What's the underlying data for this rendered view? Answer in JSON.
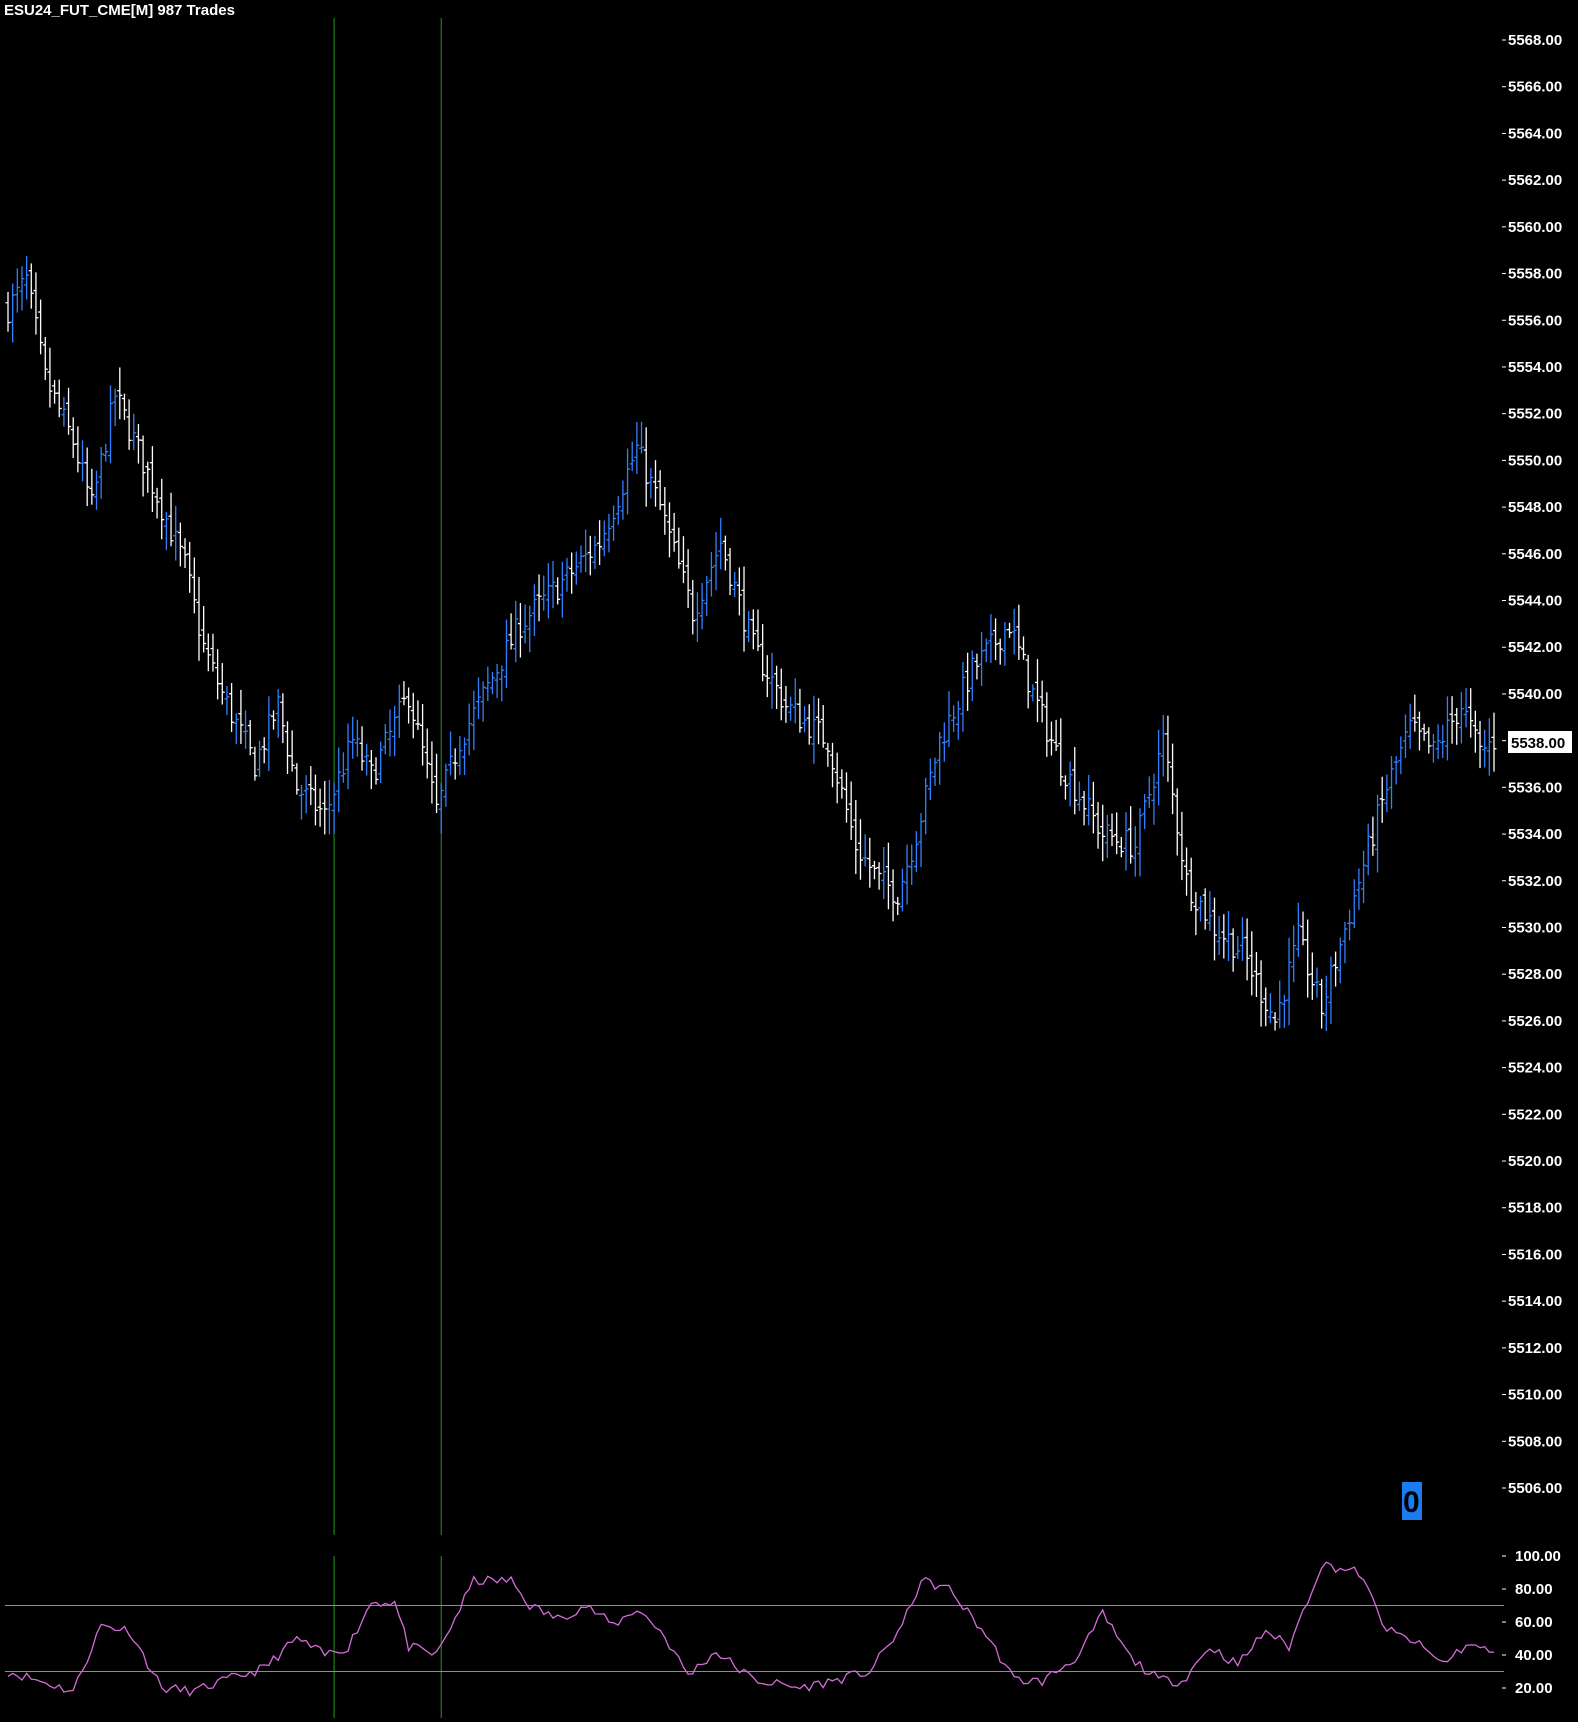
{
  "chart_title": "ESU24_FUT_CME[M] 987  Trades",
  "price_panel": {
    "y_ticks": [
      "5568.00",
      "5566.00",
      "5564.00",
      "5562.00",
      "5560.00",
      "5558.00",
      "5556.00",
      "5554.00",
      "5552.00",
      "5550.00",
      "5548.00",
      "5546.00",
      "5544.00",
      "5542.00",
      "5540.00",
      "5538.00",
      "5536.00",
      "5534.00",
      "5532.00",
      "5530.00",
      "5528.00",
      "5526.00",
      "5524.00",
      "5522.00",
      "5520.00",
      "5518.00",
      "5516.00",
      "5514.00",
      "5512.00",
      "5510.00",
      "5508.00",
      "5506.00"
    ],
    "last_price_label": "5538.00",
    "counter_label": "0"
  },
  "oscillator_panel": {
    "y_ticks": [
      "100.00",
      "80.00",
      "60.00",
      "40.00",
      "20.00"
    ]
  },
  "colors": {
    "background": "#000000",
    "bar_up": "#2f80ff",
    "bar_down": "#ffffff",
    "vertical_marker": "#1f9a1f",
    "oscillator": "#d46bd8",
    "oscillator_levels": "#20b8c8",
    "counter_box": "#1a7cf0"
  },
  "chart_data": [
    {
      "type": "ohlc",
      "title": "ESU24_FUT_CME[M] 987  Trades",
      "ylim": [
        5504,
        5570
      ],
      "x_marker_bars": [
        70,
        93
      ],
      "bar_count": 320,
      "close_path": [
        [
          0,
          5556.5
        ],
        [
          4,
          5557.7
        ],
        [
          8,
          5553.5
        ],
        [
          14,
          5550.8
        ],
        [
          18,
          5548.0
        ],
        [
          23,
          5552.8
        ],
        [
          32,
          5548.5
        ],
        [
          38,
          5545.5
        ],
        [
          42,
          5542.0
        ],
        [
          46,
          5540.0
        ],
        [
          53,
          5537.0
        ],
        [
          58,
          5539.5
        ],
        [
          62,
          5536.0
        ],
        [
          68,
          5534.8
        ],
        [
          74,
          5538.0
        ],
        [
          78,
          5536.5
        ],
        [
          86,
          5540.0
        ],
        [
          92,
          5535.0
        ],
        [
          97,
          5538.0
        ],
        [
          110,
          5543.0
        ],
        [
          120,
          5545.0
        ],
        [
          127,
          5546.5
        ],
        [
          135,
          5550.5
        ],
        [
          140,
          5548.0
        ],
        [
          147,
          5543.5
        ],
        [
          153,
          5546.5
        ],
        [
          160,
          5542.0
        ],
        [
          167,
          5539.5
        ],
        [
          176,
          5538.0
        ],
        [
          182,
          5533.5
        ],
        [
          187,
          5532.0
        ],
        [
          191,
          5531.5
        ],
        [
          195,
          5534.0
        ],
        [
          200,
          5538.0
        ],
        [
          207,
          5541.0
        ],
        [
          215,
          5543.0
        ],
        [
          220,
          5540.0
        ],
        [
          226,
          5537.0
        ],
        [
          235,
          5534.0
        ],
        [
          242,
          5533.5
        ],
        [
          248,
          5538.0
        ],
        [
          253,
          5532.0
        ],
        [
          259,
          5530.0
        ],
        [
          265,
          5529.0
        ],
        [
          272,
          5526.0
        ],
        [
          277,
          5529.5
        ],
        [
          282,
          5526.5
        ],
        [
          290,
          5532.0
        ],
        [
          296,
          5536.0
        ],
        [
          301,
          5538.5
        ],
        [
          306,
          5537.5
        ],
        [
          312,
          5539.5
        ],
        [
          316,
          5537.5
        ],
        [
          319,
          5538.0
        ]
      ]
    },
    {
      "type": "line",
      "ylim": [
        12,
        108
      ],
      "level_lines": [
        70,
        30
      ],
      "path": [
        [
          0,
          30
        ],
        [
          6,
          25
        ],
        [
          14,
          18
        ],
        [
          20,
          58
        ],
        [
          26,
          55
        ],
        [
          33,
          20
        ],
        [
          40,
          18
        ],
        [
          47,
          25
        ],
        [
          55,
          32
        ],
        [
          62,
          50
        ],
        [
          68,
          40
        ],
        [
          73,
          45
        ],
        [
          78,
          72
        ],
        [
          83,
          72
        ],
        [
          86,
          45
        ],
        [
          92,
          40
        ],
        [
          100,
          85
        ],
        [
          108,
          85
        ],
        [
          112,
          70
        ],
        [
          118,
          62
        ],
        [
          124,
          70
        ],
        [
          130,
          58
        ],
        [
          135,
          68
        ],
        [
          140,
          55
        ],
        [
          146,
          28
        ],
        [
          152,
          42
        ],
        [
          160,
          25
        ],
        [
          170,
          20
        ],
        [
          178,
          25
        ],
        [
          185,
          30
        ],
        [
          192,
          58
        ],
        [
          196,
          85
        ],
        [
          202,
          80
        ],
        [
          210,
          52
        ],
        [
          216,
          25
        ],
        [
          222,
          24
        ],
        [
          230,
          40
        ],
        [
          235,
          65
        ],
        [
          241,
          38
        ],
        [
          247,
          25
        ],
        [
          252,
          24
        ],
        [
          258,
          45
        ],
        [
          264,
          34
        ],
        [
          270,
          55
        ],
        [
          275,
          45
        ],
        [
          282,
          95
        ],
        [
          290,
          90
        ],
        [
          296,
          55
        ],
        [
          302,
          48
        ],
        [
          308,
          35
        ],
        [
          313,
          46
        ],
        [
          319,
          42
        ]
      ]
    }
  ]
}
